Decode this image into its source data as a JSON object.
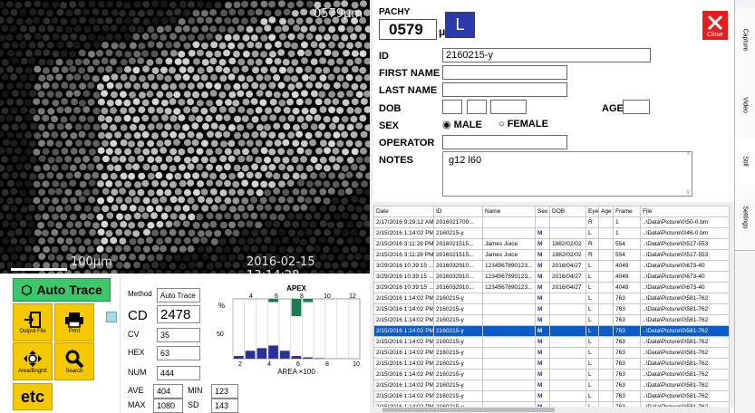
{
  "image": {
    "pachy_overlay": "0579μm",
    "scale_label": "100μm",
    "timestamp": "2016-02-15 13:14:28"
  },
  "left": {
    "auto_trace": "Auto Trace",
    "buttons": [
      {
        "label": "Output File",
        "icon": "output-file-icon"
      },
      {
        "label": "Print",
        "icon": "printer-icon"
      },
      {
        "label": "Area/Brightt",
        "icon": "area-brightness-icon"
      },
      {
        "label": "Search",
        "icon": "search-icon"
      }
    ],
    "etc": "etc",
    "method_label": "Method",
    "method_value": "Auto Trace",
    "cd_label": "CD",
    "cd_value": "2478",
    "cv_label": "CV",
    "cv_value": "35",
    "hex_label": "HEX",
    "hex_value": "63",
    "num_label": "NUM",
    "num_value": "444",
    "ave_label": "AVE",
    "ave_value": "404",
    "min_label": "MIN",
    "min_value": "123",
    "max_label": "MAX",
    "max_value": "1080",
    "sd_label": "SD",
    "sd_value": "143"
  },
  "chart_data": {
    "type": "bar",
    "title": "APEX",
    "xlabel": "AREA ×100",
    "ylabel": "%",
    "top_ticks": [
      "4",
      "6",
      "8",
      "10",
      "12"
    ],
    "bottom_ticks": [
      "2",
      "4",
      "6",
      "8",
      "10"
    ],
    "y_ticks": [
      "50"
    ],
    "bottom_series": [
      1,
      3,
      4,
      5,
      3,
      1,
      0.5,
      0.2,
      0,
      0,
      0
    ],
    "top_series": [
      0,
      0,
      0,
      3,
      0,
      16,
      3,
      0,
      0,
      0,
      0
    ],
    "ylim": [
      0,
      50
    ],
    "colors": {
      "bottom": "#2a2f9a",
      "top": "#1f7a4f"
    }
  },
  "form": {
    "pachy_label": "PACHY",
    "pachy_value": "0579",
    "pachy_unit": "μm",
    "eye": "L",
    "close": "Close",
    "id_label": "ID",
    "id_value": "2160215-y",
    "first_name_label": "FIRST NAME",
    "first_name_value": "",
    "last_name_label": "LAST NAME",
    "last_name_value": "",
    "dob_label": "DOB",
    "age_label": "AGE",
    "sex_label": "SEX",
    "male": "MALE",
    "female": "FEMALE",
    "operator_label": "OPERATOR",
    "operator_value": "",
    "notes_label": "NOTES",
    "notes_value": "g12 l60"
  },
  "table": {
    "columns": [
      "Date",
      "ID",
      "Name",
      "Sex",
      "DOB",
      "Eye",
      "Age",
      "Frame",
      "File"
    ],
    "rows": [
      [
        "2/17/2016 9:29:12 AM",
        "2016021709...",
        "",
        "",
        "",
        "R",
        "",
        "1",
        "..\\Data\\Picture\\0\\50-0.bm"
      ],
      [
        "2/15/2016 1:14:02 PM",
        "2160215-y",
        "",
        "M",
        "",
        "L",
        "",
        "1",
        "..\\Data\\Picture\\0\\46-0.bm"
      ],
      [
        "2/15/2016 3:11:28 PM",
        "2016021515...",
        "James Joice",
        "M",
        "1882/02/02",
        "R",
        "",
        "554",
        "..\\Data\\Picture\\0\\517-553"
      ],
      [
        "2/15/2016 3:11:28 PM",
        "2016021515...",
        "James Joice",
        "M",
        "1882/02/02",
        "R",
        "",
        "554",
        "..\\Data\\Picture\\0\\517-553"
      ],
      [
        "3/29/2016 10:39:15 ...",
        "2016032910...",
        "1234567890123...",
        "M",
        "2016/04/27",
        "L",
        "",
        "4049",
        "..\\Data\\Picture\\0\\673-40"
      ],
      [
        "3/29/2016 10:39:15 ...",
        "2016032910...",
        "1234567890123...",
        "M",
        "2016/04/27",
        "L",
        "",
        "4049",
        "..\\Data\\Picture\\0\\673-40"
      ],
      [
        "3/29/2016 10:39:15 ...",
        "2016032910...",
        "1234567890123...",
        "M",
        "2016/04/27",
        "L",
        "",
        "4049",
        "..\\Data\\Picture\\0\\673-40"
      ],
      [
        "2/15/2016 1:14:02 PM",
        "2160215-y",
        "",
        "M",
        "",
        "L",
        "",
        "763",
        "..\\Data\\Picture\\0\\581-762"
      ],
      [
        "2/15/2016 1:14:02 PM",
        "2160215-y",
        "",
        "M",
        "",
        "L",
        "",
        "763",
        "..\\Data\\Picture\\0\\581-762"
      ],
      [
        "2/15/2016 1:14:02 PM",
        "2160215-y",
        "",
        "M",
        "",
        "L",
        "",
        "763",
        "..\\Data\\Picture\\0\\581-762"
      ],
      [
        "2/15/2016 1:14:02 PM",
        "2160215-y",
        "",
        "M",
        "",
        "L",
        "",
        "763",
        "..\\Data\\Picture\\0\\581-762"
      ],
      [
        "2/15/2016 1:14:02 PM",
        "2160215-y",
        "",
        "M",
        "",
        "L",
        "",
        "763",
        "..\\Data\\Picture\\0\\581-762"
      ],
      [
        "2/15/2016 1:14:02 PM",
        "2160215-y",
        "",
        "M",
        "",
        "L",
        "",
        "763",
        "..\\Data\\Picture\\0\\581-762"
      ],
      [
        "2/15/2016 1:14:02 PM",
        "2160215-y",
        "",
        "M",
        "",
        "L",
        "",
        "763",
        "..\\Data\\Picture\\0\\581-762"
      ],
      [
        "2/15/2016 1:14:02 PM",
        "2160215-y",
        "",
        "M",
        "",
        "L",
        "",
        "763",
        "..\\Data\\Picture\\0\\581-762"
      ],
      [
        "2/15/2016 1:14:02 PM",
        "2160215-y",
        "",
        "M",
        "",
        "L",
        "",
        "763",
        "..\\Data\\Picture\\0\\581-762"
      ],
      [
        "2/15/2016 1:14:02 PM",
        "2160215-y",
        "",
        "M",
        "",
        "L",
        "",
        "763",
        "..\\Data\\Picture\\0\\581-762"
      ],
      [
        "2/15/2016 1:14:02 PM",
        "2160215-y",
        "",
        "M",
        "",
        "L",
        "",
        "763",
        "..\\Data\\Picture\\0\\581-762"
      ]
    ],
    "selected_index": 10
  },
  "tabs": [
    "Capture",
    "Video",
    "Still",
    "Settings"
  ],
  "active_tab": "Still"
}
